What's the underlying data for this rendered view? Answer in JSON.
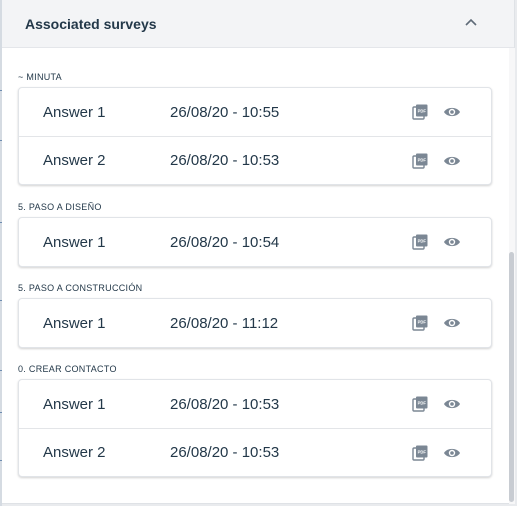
{
  "panel": {
    "title": "Associated surveys",
    "collapse_icon": "chevron-up-icon"
  },
  "sections": [
    {
      "label": "~ MINUTA",
      "rows": [
        {
          "name": "Answer 1",
          "date": "26/08/20 - 10:55"
        },
        {
          "name": "Answer 2",
          "date": "26/08/20 - 10:53"
        }
      ]
    },
    {
      "label": "5. PASO A DISEÑO",
      "rows": [
        {
          "name": "Answer 1",
          "date": "26/08/20 - 10:54"
        }
      ]
    },
    {
      "label": "5. PASO A CONSTRUCCIÓN",
      "rows": [
        {
          "name": "Answer 1",
          "date": "26/08/20 - 11:12"
        }
      ]
    },
    {
      "label": "0. CREAR CONTACTO",
      "rows": [
        {
          "name": "Answer 1",
          "date": "26/08/20 - 10:53"
        },
        {
          "name": "Answer 2",
          "date": "26/08/20 - 10:53"
        }
      ]
    }
  ],
  "icons": {
    "pdf": "pdf-file-icon",
    "view": "eye-icon"
  },
  "colors": {
    "text": "#233849",
    "icon": "#7b8794",
    "header_bg": "#f3f4f6"
  }
}
